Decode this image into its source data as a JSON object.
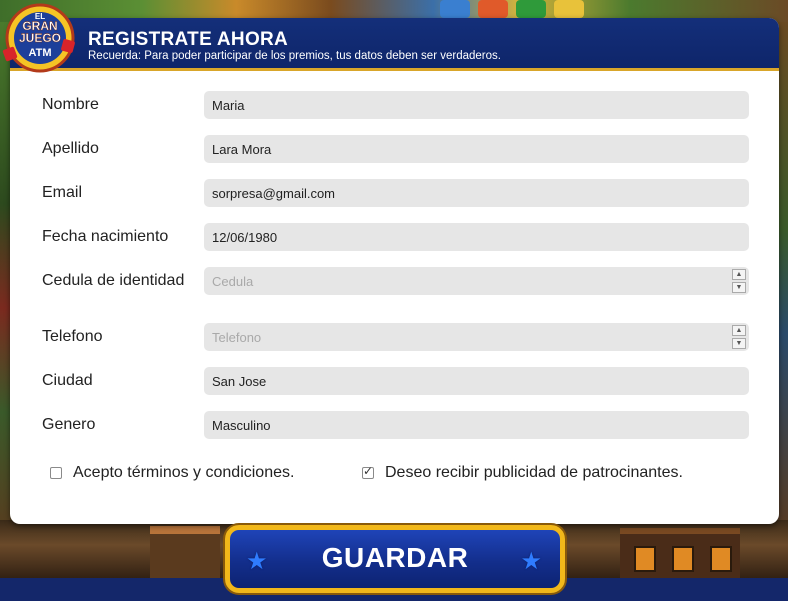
{
  "logo": {
    "text_line1": "EL",
    "text_line2": "GRAN",
    "text_line3": "JUEGO",
    "text_line4": "ATM"
  },
  "header": {
    "title": "REGISTRATE AHORA",
    "subtitle": "Recuerda: Para poder participar de los premios, tus datos deben ser verdaderos."
  },
  "form": {
    "nombre": {
      "label": "Nombre",
      "value": "Maria",
      "placeholder": ""
    },
    "apellido": {
      "label": "Apellido",
      "value": "Lara Mora",
      "placeholder": ""
    },
    "email": {
      "label": "Email",
      "value": "sorpresa@gmail.com",
      "placeholder": ""
    },
    "fecha": {
      "label": "Fecha nacimiento",
      "value": "12/06/1980",
      "placeholder": ""
    },
    "cedula": {
      "label": "Cedula de identidad",
      "value": "",
      "placeholder": "Cedula"
    },
    "telefono": {
      "label": "Telefono",
      "value": "",
      "placeholder": "Telefono"
    },
    "ciudad": {
      "label": "Ciudad",
      "value": "San Jose",
      "placeholder": ""
    },
    "genero": {
      "label": "Genero",
      "value": "Masculino",
      "placeholder": ""
    }
  },
  "checks": {
    "terms": {
      "label": "Acepto términos y condiciones.",
      "checked": false
    },
    "ads": {
      "label": "Deseo recibir publicidad de patrocinantes.",
      "checked": true
    }
  },
  "save_button": {
    "label": "GUARDAR"
  },
  "icons": {
    "spinner_up": "▲",
    "spinner_down": "▼",
    "star": "★"
  },
  "colors": {
    "header_bg": "#0e256a",
    "accent_gold": "#f2b81a",
    "button_bg": "#132e8c",
    "star": "#2f7cff",
    "input_bg": "#e6e6e6"
  }
}
